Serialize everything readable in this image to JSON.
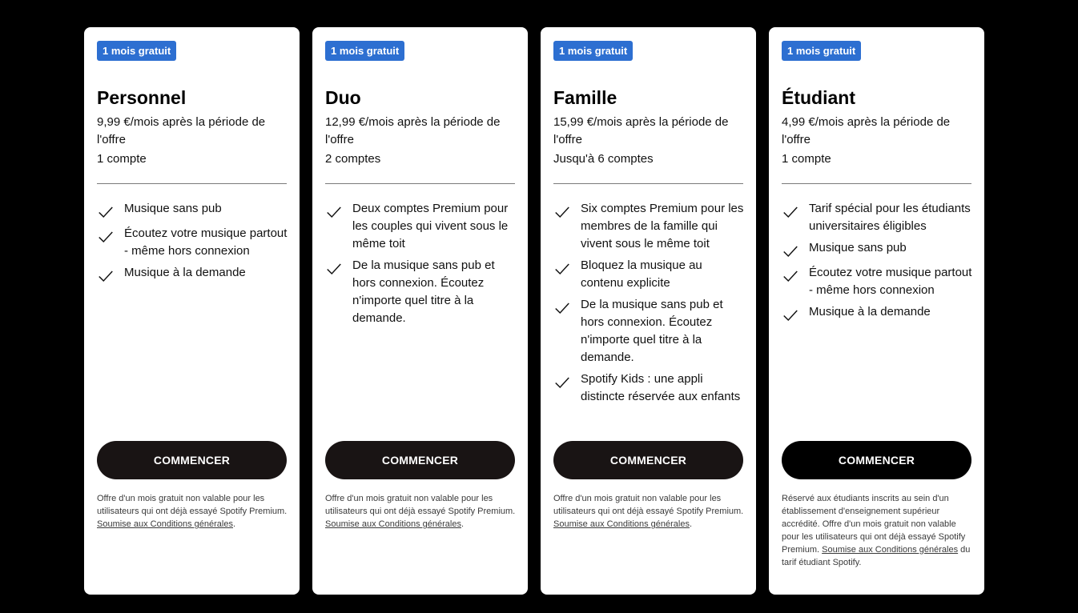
{
  "colors": {
    "page_background": "#000000",
    "card_background": "#ffffff",
    "badge": "#2d6fd1",
    "button": "#191414"
  },
  "plans": [
    {
      "badge": "1 mois gratuit",
      "name": "Personnel",
      "price": "9,99 €/mois après la période de l'offre",
      "accounts": "1 compte",
      "features": [
        "Musique sans pub",
        "Écoutez votre musique partout - même hors connexion",
        "Musique à la demande"
      ],
      "cta": "COMMENCER",
      "fineprint": "Offre d'un mois gratuit non valable pour les utilisateurs qui ont déjà essayé Spotify Premium. ",
      "fineprint_link": "Soumise aux Conditions générales",
      "fineprint_after": "."
    },
    {
      "badge": "1 mois gratuit",
      "name": "Duo",
      "price": "12,99 €/mois après la période de l'offre",
      "accounts": "2 comptes",
      "features": [
        "Deux comptes Premium pour les couples qui vivent sous le même toit",
        "De la musique sans pub et hors connexion. Écoutez n'importe quel titre à la demande."
      ],
      "cta": "COMMENCER",
      "fineprint": "Offre d'un mois gratuit non valable pour les utilisateurs qui ont déjà essayé Spotify Premium. ",
      "fineprint_link": "Soumise aux Conditions générales",
      "fineprint_after": "."
    },
    {
      "badge": "1 mois gratuit",
      "name": "Famille",
      "price": "15,99 €/mois après la période de l'offre",
      "accounts": "Jusqu'à 6 comptes",
      "features": [
        "Six comptes Premium pour les membres de la famille qui vivent sous le même toit",
        "Bloquez la musique au contenu explicite",
        "De la musique sans pub et hors connexion. Écoutez n'importe quel titre à la demande.",
        "Spotify Kids : une appli distincte réservée aux enfants"
      ],
      "cta": "COMMENCER",
      "fineprint": "Offre d'un mois gratuit non valable pour les utilisateurs qui ont déjà essayé Spotify Premium. ",
      "fineprint_link": "Soumise aux Conditions générales",
      "fineprint_after": "."
    },
    {
      "badge": "1 mois gratuit",
      "name": "Étudiant",
      "price": "4,99 €/mois après la période de l'offre",
      "accounts": "1 compte",
      "features": [
        "Tarif spécial pour les étudiants universitaires éligibles",
        "Musique sans pub",
        "Écoutez votre musique partout - même hors connexion",
        "Musique à la demande"
      ],
      "cta": "COMMENCER",
      "fineprint": "Réservé aux étudiants inscrits au sein d'un établissement d'enseignement supérieur accrédité. Offre d'un mois gratuit non valable pour les utilisateurs qui ont déjà essayé Spotify Premium. ",
      "fineprint_link": "Soumise aux Conditions générales",
      "fineprint_after": " du tarif étudiant Spotify."
    }
  ]
}
